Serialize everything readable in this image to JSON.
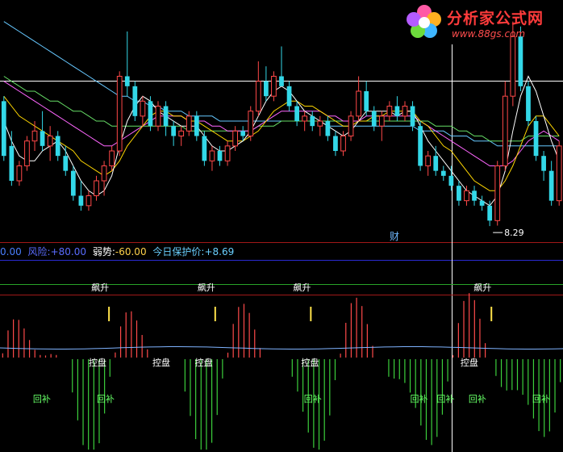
{
  "logo": {
    "title": "分析家公式网",
    "url": "www.88gs.com"
  },
  "indicator_bar": {
    "items": [
      {
        "label": "",
        "value": "0.00",
        "color": "#4a7fff"
      },
      {
        "label": "风险:",
        "value": "+80.00",
        "color": "#5a6cff"
      },
      {
        "label": "弱势:",
        "value": "-60.00",
        "color": "#ffd24a"
      },
      {
        "label": "今日保护价:",
        "value": "+8.69",
        "color": "#6ad0ff"
      }
    ]
  },
  "chart_data": [
    {
      "type": "candlestick",
      "annotations": {
        "low_label": "8.29",
        "event_label": "财"
      },
      "colors": {
        "up": "#ff4848",
        "down": "#33d8e8",
        "ma_short": "#ffffff",
        "ma_mid": "#ffd700",
        "ma_pink": "#ff66ff",
        "ma_green": "#66dd66",
        "ma_long": "#66c8ff"
      },
      "candles_ohlc": [
        [
          10.8,
          10.9,
          9.6,
          9.7
        ],
        [
          9.9,
          10.2,
          9.1,
          9.2
        ],
        [
          9.2,
          9.6,
          9.1,
          9.5
        ],
        [
          9.5,
          10.1,
          9.4,
          10.0
        ],
        [
          10.0,
          10.4,
          9.8,
          10.2
        ],
        [
          10.2,
          10.6,
          9.8,
          9.9
        ],
        [
          9.9,
          10.3,
          9.6,
          10.1
        ],
        [
          10.1,
          10.2,
          9.6,
          9.7
        ],
        [
          9.7,
          9.9,
          9.3,
          9.4
        ],
        [
          9.4,
          9.5,
          8.8,
          8.9
        ],
        [
          8.9,
          9.2,
          8.6,
          8.7
        ],
        [
          8.7,
          9.0,
          8.6,
          8.9
        ],
        [
          8.9,
          9.3,
          8.8,
          9.2
        ],
        [
          9.2,
          9.6,
          8.9,
          9.5
        ],
        [
          9.5,
          9.9,
          9.4,
          9.8
        ],
        [
          9.8,
          11.4,
          9.7,
          11.3
        ],
        [
          11.3,
          12.2,
          10.9,
          11.1
        ],
        [
          11.1,
          11.2,
          10.4,
          10.5
        ],
        [
          10.5,
          10.9,
          10.3,
          10.8
        ],
        [
          10.8,
          10.9,
          10.2,
          10.3
        ],
        [
          10.3,
          10.8,
          10.2,
          10.7
        ],
        [
          10.7,
          10.8,
          10.1,
          10.3
        ],
        [
          10.3,
          10.4,
          9.9,
          10.1
        ],
        [
          10.1,
          10.3,
          9.9,
          10.2
        ],
        [
          10.2,
          10.6,
          10.1,
          10.5
        ],
        [
          10.5,
          10.6,
          10.0,
          10.1
        ],
        [
          10.1,
          10.2,
          9.5,
          9.6
        ],
        [
          9.6,
          9.9,
          9.4,
          9.8
        ],
        [
          9.8,
          9.9,
          9.5,
          9.6
        ],
        [
          9.6,
          10.0,
          9.5,
          9.9
        ],
        [
          9.9,
          10.3,
          9.8,
          10.2
        ],
        [
          10.2,
          10.3,
          10.0,
          10.1
        ],
        [
          10.1,
          10.7,
          10.0,
          10.6
        ],
        [
          10.6,
          11.6,
          10.5,
          11.2
        ],
        [
          11.2,
          11.5,
          10.8,
          10.9
        ],
        [
          10.9,
          11.4,
          10.8,
          11.3
        ],
        [
          11.3,
          11.9,
          11.1,
          11.1
        ],
        [
          11.1,
          11.2,
          10.6,
          10.7
        ],
        [
          10.7,
          10.8,
          10.3,
          10.4
        ],
        [
          10.4,
          10.6,
          10.2,
          10.5
        ],
        [
          10.5,
          10.6,
          10.2,
          10.3
        ],
        [
          10.3,
          10.5,
          10.1,
          10.4
        ],
        [
          10.4,
          10.5,
          10.0,
          10.1
        ],
        [
          10.1,
          10.2,
          9.7,
          9.8
        ],
        [
          9.8,
          10.2,
          9.7,
          10.1
        ],
        [
          10.1,
          10.6,
          10.0,
          10.5
        ],
        [
          10.5,
          11.3,
          10.4,
          11.0
        ],
        [
          11.0,
          11.2,
          10.5,
          10.6
        ],
        [
          10.6,
          10.7,
          10.2,
          10.3
        ],
        [
          10.3,
          10.6,
          10.0,
          10.5
        ],
        [
          10.5,
          10.8,
          10.4,
          10.7
        ],
        [
          10.7,
          10.9,
          10.4,
          10.5
        ],
        [
          10.5,
          10.8,
          10.4,
          10.7
        ],
        [
          10.7,
          10.8,
          10.2,
          10.3
        ],
        [
          10.3,
          10.4,
          9.4,
          9.5
        ],
        [
          9.5,
          9.8,
          9.3,
          9.7
        ],
        [
          9.7,
          9.9,
          9.3,
          9.4
        ],
        [
          9.4,
          9.5,
          9.2,
          9.3
        ],
        [
          9.3,
          9.5,
          9.0,
          9.1
        ],
        [
          9.1,
          9.2,
          8.7,
          8.8
        ],
        [
          8.8,
          9.1,
          8.7,
          9.0
        ],
        [
          9.0,
          9.1,
          8.7,
          8.8
        ],
        [
          8.8,
          8.9,
          8.6,
          8.7
        ],
        [
          8.7,
          8.8,
          8.29,
          8.4
        ],
        [
          8.4,
          9.6,
          8.3,
          9.5
        ],
        [
          9.5,
          11.2,
          9.4,
          10.9
        ],
        [
          10.9,
          12.4,
          10.7,
          12.1
        ],
        [
          12.1,
          12.3,
          11.0,
          11.1
        ],
        [
          11.1,
          11.2,
          10.3,
          10.4
        ],
        [
          10.4,
          10.5,
          9.6,
          9.7
        ],
        [
          9.7,
          9.8,
          9.2,
          9.4
        ],
        [
          9.4,
          9.6,
          8.7,
          8.8
        ],
        [
          8.8,
          10.0,
          8.7,
          9.9
        ]
      ],
      "moving_averages_close": {
        "ma_short": [
          10.4,
          10.0,
          9.7,
          9.6,
          9.6,
          9.8,
          9.9,
          10.0,
          9.8,
          9.5,
          9.2,
          9.0,
          8.9,
          9.0,
          9.3,
          9.9,
          10.4,
          10.7,
          10.9,
          10.8,
          10.6,
          10.5,
          10.4,
          10.3,
          10.3,
          10.3,
          10.1,
          9.9,
          9.8,
          9.8,
          9.9,
          10.0,
          10.2,
          10.5,
          10.8,
          11.0,
          11.1,
          11.0,
          10.8,
          10.6,
          10.5,
          10.4,
          10.3,
          10.2,
          10.1,
          10.2,
          10.4,
          10.6,
          10.6,
          10.6,
          10.6,
          10.5,
          10.6,
          10.6,
          10.3,
          10.0,
          9.8,
          9.6,
          9.4,
          9.2,
          9.0,
          8.9,
          8.8,
          8.7,
          8.9,
          9.4,
          10.2,
          10.9,
          11.3,
          11.0,
          10.5,
          10.0,
          9.6
        ],
        "ma_mid": [
          10.9,
          10.7,
          10.5,
          10.4,
          10.3,
          10.2,
          10.1,
          10.0,
          9.9,
          9.8,
          9.6,
          9.5,
          9.4,
          9.3,
          9.4,
          9.6,
          9.9,
          10.1,
          10.3,
          10.5,
          10.6,
          10.6,
          10.5,
          10.5,
          10.4,
          10.4,
          10.3,
          10.2,
          10.1,
          10.0,
          10.0,
          10.0,
          10.1,
          10.2,
          10.4,
          10.6,
          10.7,
          10.8,
          10.8,
          10.7,
          10.7,
          10.6,
          10.5,
          10.4,
          10.3,
          10.3,
          10.4,
          10.4,
          10.5,
          10.5,
          10.6,
          10.6,
          10.6,
          10.6,
          10.4,
          10.3,
          10.1,
          9.9,
          9.8,
          9.6,
          9.4,
          9.2,
          9.1,
          9.0,
          9.0,
          9.2,
          9.5,
          9.9,
          10.3,
          10.5,
          10.5,
          10.3,
          10.1
        ],
        "ma_pink": [
          11.2,
          11.1,
          11.0,
          10.9,
          10.8,
          10.7,
          10.6,
          10.5,
          10.4,
          10.3,
          10.2,
          10.1,
          10.0,
          9.9,
          9.9,
          10.0,
          10.1,
          10.2,
          10.3,
          10.4,
          10.5,
          10.5,
          10.5,
          10.5,
          10.4,
          10.4,
          10.4,
          10.3,
          10.3,
          10.2,
          10.2,
          10.2,
          10.2,
          10.3,
          10.4,
          10.5,
          10.6,
          10.6,
          10.6,
          10.6,
          10.6,
          10.6,
          10.5,
          10.5,
          10.4,
          10.4,
          10.4,
          10.5,
          10.5,
          10.5,
          10.5,
          10.5,
          10.5,
          10.5,
          10.4,
          10.3,
          10.2,
          10.1,
          10.0,
          9.9,
          9.8,
          9.7,
          9.6,
          9.5,
          9.5,
          9.5,
          9.6,
          9.8,
          10.0,
          10.1,
          10.2,
          10.1,
          10.0
        ],
        "ma_green": [
          11.3,
          11.2,
          11.1,
          11.0,
          11.0,
          10.9,
          10.8,
          10.8,
          10.7,
          10.6,
          10.6,
          10.5,
          10.4,
          10.4,
          10.3,
          10.3,
          10.3,
          10.3,
          10.3,
          10.3,
          10.3,
          10.3,
          10.3,
          10.3,
          10.2,
          10.2,
          10.2,
          10.2,
          10.2,
          10.2,
          10.2,
          10.2,
          10.2,
          10.3,
          10.3,
          10.3,
          10.4,
          10.4,
          10.4,
          10.4,
          10.4,
          10.4,
          10.4,
          10.4,
          10.4,
          10.4,
          10.4,
          10.4,
          10.4,
          10.4,
          10.4,
          10.4,
          10.4,
          10.4,
          10.4,
          10.4,
          10.3,
          10.3,
          10.3,
          10.2,
          10.2,
          10.1,
          10.1,
          10.0,
          10.0,
          10.0,
          10.0,
          10.0,
          10.1,
          10.1,
          10.1,
          10.1,
          10.1
        ],
        "ma_long": [
          12.4,
          12.3,
          12.2,
          12.1,
          12.0,
          11.9,
          11.8,
          11.7,
          11.6,
          11.5,
          11.4,
          11.3,
          11.2,
          11.1,
          11.0,
          10.9,
          10.9,
          10.8,
          10.8,
          10.7,
          10.7,
          10.6,
          10.6,
          10.6,
          10.5,
          10.5,
          10.5,
          10.5,
          10.4,
          10.4,
          10.4,
          10.4,
          10.4,
          10.4,
          10.4,
          10.4,
          10.4,
          10.4,
          10.4,
          10.4,
          10.4,
          10.4,
          10.3,
          10.3,
          10.3,
          10.3,
          10.3,
          10.3,
          10.3,
          10.3,
          10.3,
          10.3,
          10.3,
          10.3,
          10.2,
          10.2,
          10.2,
          10.2,
          10.1,
          10.1,
          10.1,
          10.0,
          10.0,
          10.0,
          9.9,
          9.9,
          9.9,
          9.9,
          9.9,
          9.9,
          9.9,
          9.9,
          9.9
        ]
      },
      "ylim": [
        8.0,
        12.8
      ]
    },
    {
      "type": "bar",
      "text_labels": {
        "rise": "飙升",
        "control": "控盘",
        "rebound": "回补"
      },
      "rise_positions": [
        19,
        39,
        57,
        91
      ],
      "control_positions": [
        17,
        29,
        37,
        57,
        87
      ],
      "rebound_positions": [
        5,
        17,
        56,
        76,
        81,
        87,
        99
      ],
      "colors": {
        "red": "#ff4a4a",
        "green": "#3ccf3c",
        "yellow": "#ffe24a",
        "line_green": "#29a329",
        "line_blue": "#7fb3ff"
      }
    }
  ]
}
